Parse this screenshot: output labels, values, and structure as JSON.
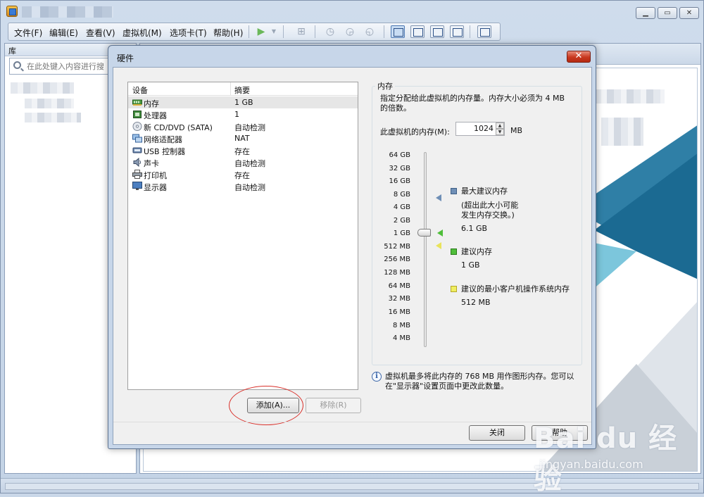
{
  "menu": [
    "文件(F)",
    "编辑(E)",
    "查看(V)",
    "虚拟机(M)",
    "选项卡(T)",
    "帮助(H)"
  ],
  "library": {
    "title": "库",
    "search_placeholder": "在此处键入内容进行搜"
  },
  "watermark": {
    "logo": "Bai du 经验",
    "url": "jingyan.baidu.com"
  },
  "dialog": {
    "title": "硬件",
    "close_glyph": "✕",
    "columns": {
      "device": "设备",
      "summary": "摘要"
    },
    "devices": [
      {
        "name": "内存",
        "summary": "1 GB",
        "icon": "memory-icon"
      },
      {
        "name": "处理器",
        "summary": "1",
        "icon": "cpu-icon"
      },
      {
        "name": "新 CD/DVD (SATA)",
        "summary": "自动检测",
        "icon": "cd-dvd-icon"
      },
      {
        "name": "网络适配器",
        "summary": "NAT",
        "icon": "network-icon"
      },
      {
        "name": "USB 控制器",
        "summary": "存在",
        "icon": "usb-icon"
      },
      {
        "name": "声卡",
        "summary": "自动检测",
        "icon": "sound-icon"
      },
      {
        "name": "打印机",
        "summary": "存在",
        "icon": "printer-icon"
      },
      {
        "name": "显示器",
        "summary": "自动检测",
        "icon": "monitor-icon"
      }
    ],
    "add_button": "添加(A)...",
    "remove_button": "移除(R)",
    "close_button": "关闭",
    "help_button": "帮助",
    "memory": {
      "group_title": "内存",
      "desc_line1": "指定分配给此虚拟机的内存量。内存大小必须为 4 MB",
      "desc_line2": "的倍数。",
      "label": "此虚拟机的内存(M):",
      "value": "1024",
      "unit": "MB",
      "ticks": [
        "64 GB",
        "32 GB",
        "16 GB",
        "8 GB",
        "4 GB",
        "2 GB",
        "1 GB",
        "512 MB",
        "256 MB",
        "128 MB",
        "64 MB",
        "32 MB",
        "16 MB",
        "8 MB",
        "4 MB"
      ],
      "legend_max": {
        "title": "最大建议内存",
        "note1": "(超出此大小可能",
        "note2": "发生内存交换。)",
        "value": "6.1 GB",
        "color": "#6f8fb6"
      },
      "legend_recommended": {
        "title": "建议内存",
        "value": "1 GB",
        "color": "#4fbe3a"
      },
      "legend_min": {
        "title": "建议的最小客户机操作系统内存",
        "value": "512 MB",
        "color": "#f0ee60"
      },
      "info_line1": "虚拟机最多将此内存的 768 MB 用作图形内存。您可以",
      "info_line2": "在\"显示器\"设置页面中更改此数量。"
    }
  }
}
